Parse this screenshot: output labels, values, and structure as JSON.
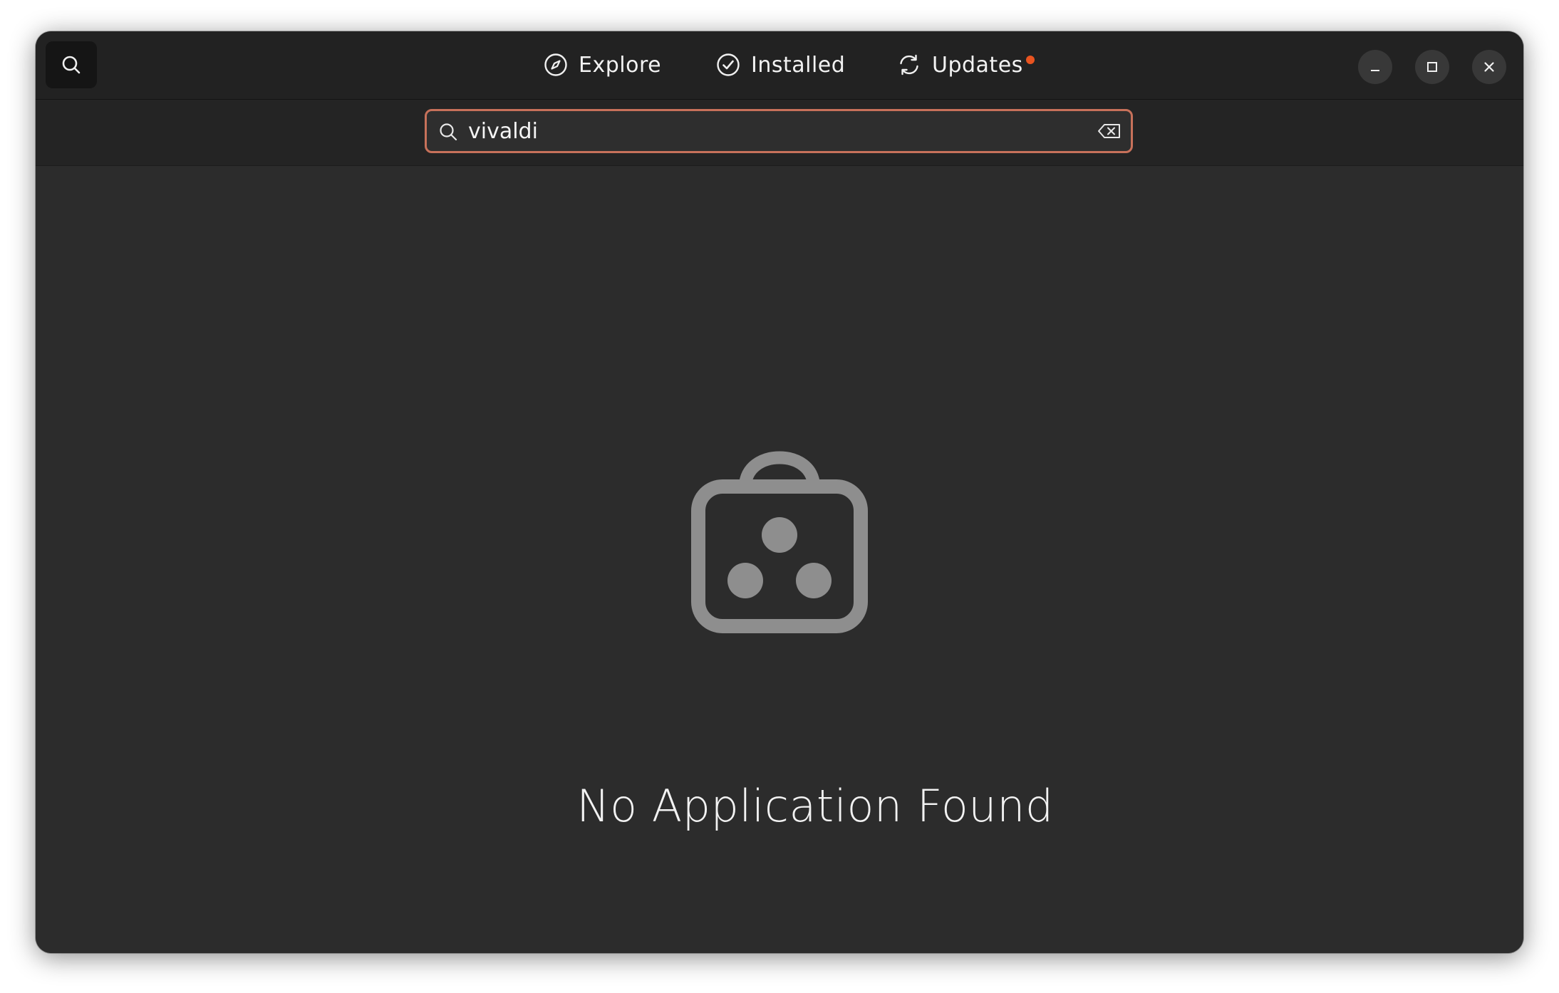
{
  "header": {
    "tabs": [
      {
        "label": "Explore",
        "icon": "compass-icon"
      },
      {
        "label": "Installed",
        "icon": "check-circle-icon"
      },
      {
        "label": "Updates",
        "icon": "refresh-icon",
        "has_badge": true
      }
    ],
    "search_toggle_icon": "search-icon",
    "window_controls": [
      "minimize-icon",
      "maximize-icon",
      "close-icon"
    ]
  },
  "search": {
    "value": "vivaldi",
    "icon": "search-icon",
    "clear_icon": "backspace-clear-icon"
  },
  "empty_state": {
    "icon": "app-store-bag-icon",
    "message": "No Application Found"
  },
  "colors": {
    "accent": "#e95420",
    "entry_border": "#c7715a",
    "window_bg": "#2c2c2c",
    "header_bg": "#222222"
  }
}
